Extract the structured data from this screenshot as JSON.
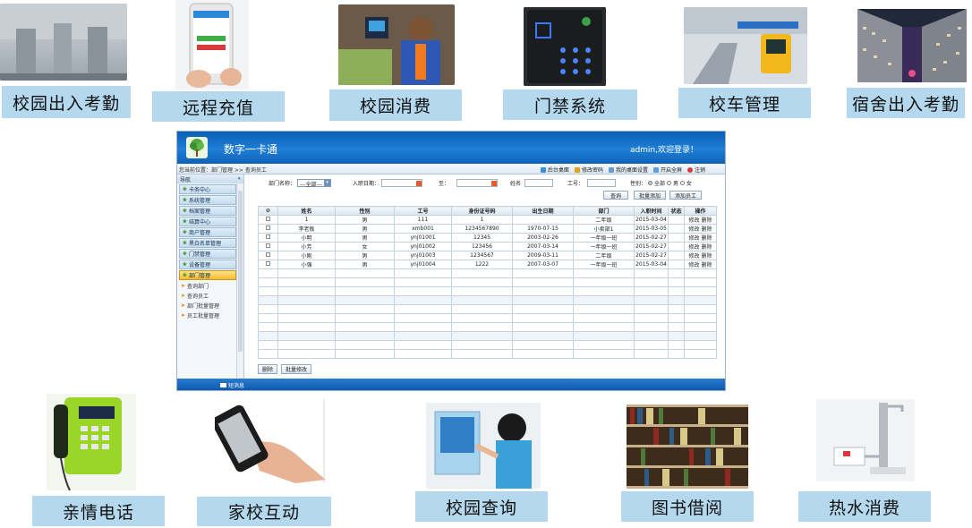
{
  "features_top": [
    {
      "label": "校园出入考勤",
      "icon": "turnstile-gate-photo"
    },
    {
      "label": "远程充值",
      "icon": "smartphone-photo"
    },
    {
      "label": "校园消费",
      "icon": "student-card-reader-photo"
    },
    {
      "label": "门禁系统",
      "icon": "access-keypad-photo"
    },
    {
      "label": "校车管理",
      "icon": "bus-card-reader-photo"
    },
    {
      "label": "宿舍出入考勤",
      "icon": "dormitory-building-photo"
    }
  ],
  "features_bottom": [
    {
      "label": "亲情电话",
      "icon": "school-phone-photo"
    },
    {
      "label": "家校互动",
      "icon": "phone-in-hand-photo"
    },
    {
      "label": "校园查询",
      "icon": "student-kiosk-photo"
    },
    {
      "label": "图书借阅",
      "icon": "bookshelf-photo"
    },
    {
      "label": "热水消费",
      "icon": "hot-water-faucet-photo"
    }
  ],
  "app": {
    "title": "数字一卡通",
    "user_greeting": "admin,欢迎登录！",
    "breadcrumb": "您当前位置：部门管理 >> 查询员工",
    "toolbar": [
      "后台桌面",
      "修改密码",
      "我的桌面设置",
      "开启全屏",
      "注销"
    ],
    "sidebar": {
      "heading": "导航",
      "collapse": "«",
      "items": [
        "卡务中心",
        "系统管理",
        "档案管理",
        "结算中心",
        "商户管理",
        "黑白名单管理",
        "门禁管理",
        "设备管理",
        "部门管理"
      ],
      "active": "部门管理",
      "subitems": [
        "查询部门",
        "查询员工",
        "部门批量管理",
        "员工批量管理"
      ]
    },
    "filters": {
      "dept_label": "部门名称：",
      "dept_value": "---全部---",
      "date_label": "入职日期：",
      "to_label": "至：",
      "name_label": "姓名",
      "id_label": "工号：",
      "gender_label": "性别：",
      "gender_options": [
        "全部",
        "男",
        "女"
      ],
      "gender_selected": "全部",
      "search_button": "查询",
      "batch_add_button": "批量添加",
      "add_button": "添加员工"
    },
    "table": {
      "columns": [
        "姓名",
        "性别",
        "工号",
        "身份证号码",
        "出生日期",
        "部门",
        "入职时间",
        "状态",
        "操作"
      ],
      "rows": [
        {
          "name": "1",
          "gender": "男",
          "id": "111",
          "idcard": "1",
          "birth": "",
          "dept": "二年级",
          "joined": "2015-03-04",
          "status": "",
          "ops": "修改 删除"
        },
        {
          "name": "李老板",
          "gender": "男",
          "id": "xmb001",
          "idcard": "1234567890",
          "birth": "1970-07-15",
          "dept": "小卖部1",
          "joined": "2015-03-05",
          "status": "",
          "ops": "修改 删除"
        },
        {
          "name": "小明",
          "gender": "男",
          "id": "ynj01001",
          "idcard": "12345",
          "birth": "2003-02-26",
          "dept": "一年级一班",
          "joined": "2015-02-27",
          "status": "",
          "ops": "修改 删除"
        },
        {
          "name": "小芳",
          "gender": "女",
          "id": "ynj01002",
          "idcard": "123456",
          "birth": "2007-03-14",
          "dept": "一年级一班",
          "joined": "2015-02-27",
          "status": "",
          "ops": "修改 删除"
        },
        {
          "name": "小刚",
          "gender": "男",
          "id": "ynj01003",
          "idcard": "1234567",
          "birth": "2009-03-11",
          "dept": "二年级",
          "joined": "2015-02-27",
          "status": "",
          "ops": "修改 删除"
        },
        {
          "name": "小强",
          "gender": "男",
          "id": "ynj01004",
          "idcard": "1222",
          "birth": "2007-03-07",
          "dept": "一年级一班",
          "joined": "2015-03-04",
          "status": "",
          "ops": "修改 删除"
        }
      ]
    },
    "bottom_buttons": [
      "删除",
      "批量修改"
    ],
    "footer_message": "短消息"
  }
}
